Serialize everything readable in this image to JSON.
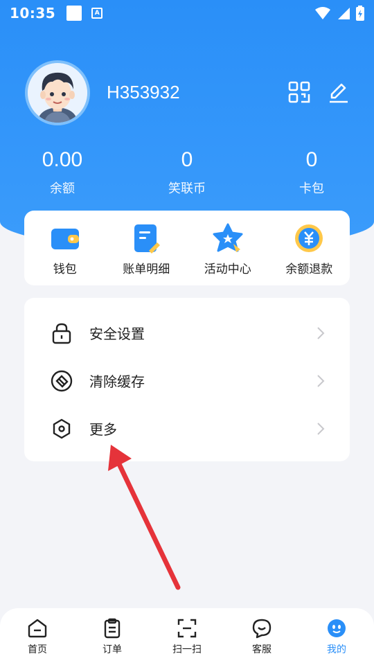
{
  "status_bar": {
    "time": "10:35"
  },
  "profile": {
    "username": "H353932"
  },
  "stats": [
    {
      "value": "0.00",
      "label": "余额"
    },
    {
      "value": "0",
      "label": "笑联币"
    },
    {
      "value": "0",
      "label": "卡包"
    }
  ],
  "quick_actions": [
    {
      "label": "钱包",
      "icon": "wallet-icon"
    },
    {
      "label": "账单明细",
      "icon": "bill-icon"
    },
    {
      "label": "活动中心",
      "icon": "activity-star-icon"
    },
    {
      "label": "余额退款",
      "icon": "refund-yuan-icon"
    }
  ],
  "menu": [
    {
      "label": "安全设置",
      "icon": "lock-icon"
    },
    {
      "label": "清除缓存",
      "icon": "eraser-icon"
    },
    {
      "label": "更多",
      "icon": "hexagon-icon"
    }
  ],
  "tabbar": [
    {
      "label": "首页",
      "icon": "home-icon"
    },
    {
      "label": "订单",
      "icon": "clipboard-icon"
    },
    {
      "label": "扫一扫",
      "icon": "scan-icon"
    },
    {
      "label": "客服",
      "icon": "chat-icon"
    },
    {
      "label": "我的",
      "icon": "profile-face-icon",
      "active": true
    }
  ],
  "colors": {
    "primary": "#2a8ff8",
    "background": "#f3f4f8",
    "annotation_arrow": "#e5333a"
  }
}
